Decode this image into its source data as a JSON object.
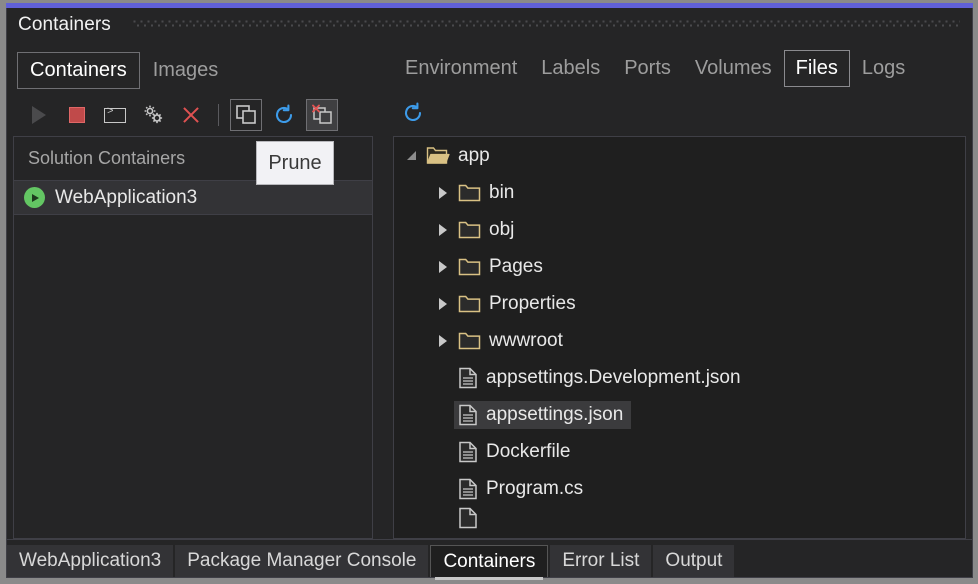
{
  "window": {
    "title": "Containers",
    "accent_color": "#6060d8"
  },
  "left_pane": {
    "tabs": [
      {
        "label": "Containers",
        "active": true
      },
      {
        "label": "Images",
        "active": false
      }
    ],
    "toolbar": [
      {
        "name": "run-button",
        "icon": "play-icon",
        "state": "disabled"
      },
      {
        "name": "stop-button",
        "icon": "stop-square-icon",
        "state": "enabled"
      },
      {
        "name": "open-terminal-button",
        "icon": "terminal-icon",
        "state": "enabled"
      },
      {
        "name": "settings-button",
        "icon": "gears-icon",
        "state": "enabled"
      },
      {
        "name": "remove-button",
        "icon": "close-x-icon",
        "state": "enabled"
      },
      {
        "name": "show-all-containers-button",
        "icon": "stacked-windows-icon",
        "state": "boxed"
      },
      {
        "name": "refresh-button",
        "icon": "refresh-icon",
        "state": "enabled"
      },
      {
        "name": "prune-button",
        "icon": "prune-icon",
        "state": "hovered"
      }
    ],
    "list_header": "Solution Containers",
    "containers": [
      {
        "name": "WebApplication3",
        "status_icon": "running-green-icon"
      }
    ]
  },
  "tooltip": {
    "text": "Prune"
  },
  "right_pane": {
    "tabs": [
      {
        "label": "Environment",
        "active": false
      },
      {
        "label": "Labels",
        "active": false
      },
      {
        "label": "Ports",
        "active": false
      },
      {
        "label": "Volumes",
        "active": false
      },
      {
        "label": "Files",
        "active": true
      },
      {
        "label": "Logs",
        "active": false
      }
    ],
    "toolbar": [
      {
        "name": "refresh-files-button",
        "icon": "refresh-icon"
      }
    ],
    "tree": [
      {
        "label": "app",
        "type": "folder-open",
        "depth": 0,
        "expanded": true,
        "selected": false
      },
      {
        "label": "bin",
        "type": "folder",
        "depth": 1,
        "expanded": false,
        "selected": false
      },
      {
        "label": "obj",
        "type": "folder",
        "depth": 1,
        "expanded": false,
        "selected": false
      },
      {
        "label": "Pages",
        "type": "folder",
        "depth": 1,
        "expanded": false,
        "selected": false
      },
      {
        "label": "Properties",
        "type": "folder",
        "depth": 1,
        "expanded": false,
        "selected": false
      },
      {
        "label": "wwwroot",
        "type": "folder",
        "depth": 1,
        "expanded": false,
        "selected": false
      },
      {
        "label": "appsettings.Development.json",
        "type": "file",
        "depth": 1,
        "expanded": false,
        "selected": false
      },
      {
        "label": "appsettings.json",
        "type": "file",
        "depth": 1,
        "expanded": false,
        "selected": true
      },
      {
        "label": "Dockerfile",
        "type": "file",
        "depth": 1,
        "expanded": false,
        "selected": false
      },
      {
        "label": "Program.cs",
        "type": "file",
        "depth": 1,
        "expanded": false,
        "selected": false
      }
    ]
  },
  "bottom_tabs": [
    {
      "label": "WebApplication3",
      "active": false
    },
    {
      "label": "Package Manager Console",
      "active": false
    },
    {
      "label": "Containers",
      "active": true
    },
    {
      "label": "Error List",
      "active": false
    },
    {
      "label": "Output",
      "active": false
    }
  ]
}
